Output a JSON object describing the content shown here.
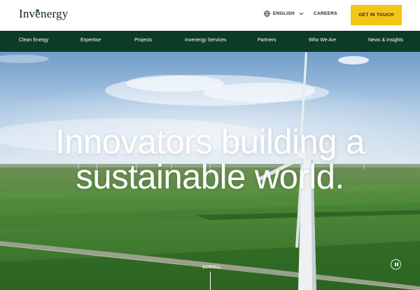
{
  "header": {
    "logo": "Invenergy",
    "language": "ENGLISH",
    "careers": "CAREERS",
    "cta": "GET IN TOUCH"
  },
  "nav": {
    "items": [
      {
        "label": "Clean Energy"
      },
      {
        "label": "Expertise"
      },
      {
        "label": "Projects"
      },
      {
        "label": "Invenergy Services"
      },
      {
        "label": "Partners"
      },
      {
        "label": "Who We Are"
      },
      {
        "label": "News & Insights"
      }
    ]
  },
  "hero": {
    "headline_line1": "Innovators building a",
    "headline_line2": "sustainable world.",
    "scroll": "SCROLL"
  },
  "colors": {
    "nav_bg": "#0c3b27",
    "cta_bg": "#f5c418",
    "logo_dot": "#1f7a4a"
  },
  "icons": {
    "language": "globe-icon",
    "language_toggle": "chevron-down-icon",
    "media_control": "pause-icon"
  }
}
